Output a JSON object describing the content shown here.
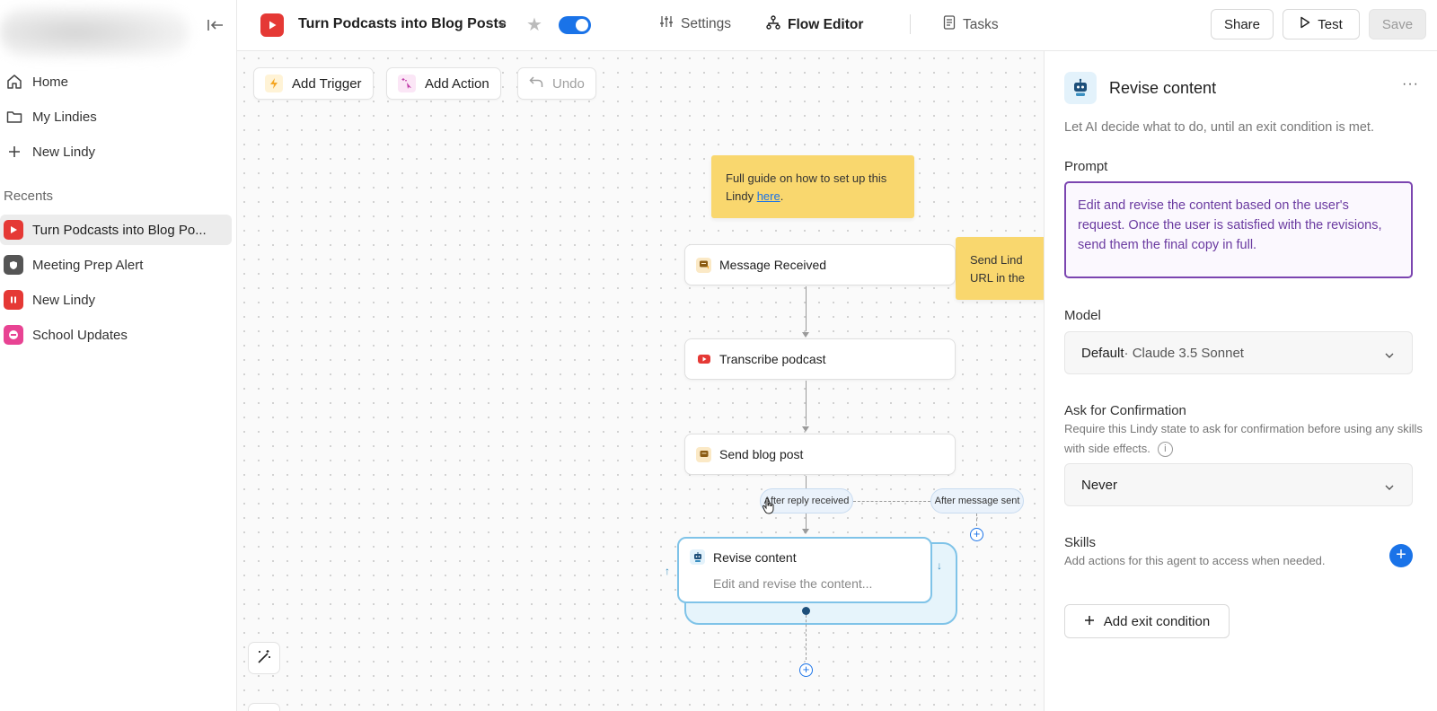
{
  "sidebar": {
    "nav": [
      {
        "label": "Home",
        "icon": "home-icon"
      },
      {
        "label": "My Lindies",
        "icon": "folder-icon"
      },
      {
        "label": "New Lindy",
        "icon": "plus-icon"
      }
    ],
    "recents_label": "Recents",
    "recents": [
      {
        "label": "Turn Podcasts into Blog Po...",
        "icon": "play-icon",
        "color": "#e53935"
      },
      {
        "label": "Meeting Prep Alert",
        "icon": "shield-icon",
        "color": "#555555"
      },
      {
        "label": "New Lindy",
        "icon": "pause-icon",
        "color": "#e53935"
      },
      {
        "label": "School Updates",
        "icon": "minus-circle-icon",
        "color": "#e84393"
      }
    ]
  },
  "topbar": {
    "title": "Turn Podcasts into Blog Posts",
    "enabled": true,
    "tabs": [
      {
        "label": "Settings",
        "icon": "sliders-icon"
      },
      {
        "label": "Flow Editor",
        "icon": "flow-icon"
      },
      {
        "label": "Tasks",
        "icon": "document-icon"
      }
    ],
    "share_label": "Share",
    "test_label": "Test",
    "save_label": "Save",
    "accent": "#1a73e8"
  },
  "canvas": {
    "toolbar": {
      "add_trigger": "Add Trigger",
      "add_action": "Add Action",
      "undo": "Undo"
    },
    "sticky_note": {
      "text": "Full guide on how to set up this Lindy ",
      "link": "here",
      "after": "."
    },
    "sticky_note_2": {
      "line1": "Send Lind",
      "line2": "URL in the"
    },
    "nodes": [
      {
        "label": "Message Received",
        "icon": "message-icon"
      },
      {
        "label": "Transcribe podcast",
        "icon": "youtube-icon"
      },
      {
        "label": "Send blog post",
        "icon": "message-icon"
      }
    ],
    "branches": {
      "reply": "After reply received",
      "sent": "After message sent"
    },
    "agent_node": {
      "title": "Revise content",
      "desc": "Edit and revise the content..."
    }
  },
  "panel": {
    "title": "Revise content",
    "description": "Let AI decide what to do, until an exit condition is met.",
    "prompt_label": "Prompt",
    "prompt_value": "Edit and revise the content based on the user's request. Once the user is satisfied with the revisions, send them the final copy in full.",
    "model_label": "Model",
    "model_value_bold": "Default",
    "model_value_rest": " · Claude 3.5 Sonnet",
    "confirm_label": "Ask for Confirmation",
    "confirm_desc": "Require this Lindy state to ask for confirmation before using any skills with side effects.",
    "confirm_value": "Never",
    "skills_label": "Skills",
    "skills_desc": "Add actions for this agent to access when needed.",
    "exit_label": "Add exit condition"
  }
}
